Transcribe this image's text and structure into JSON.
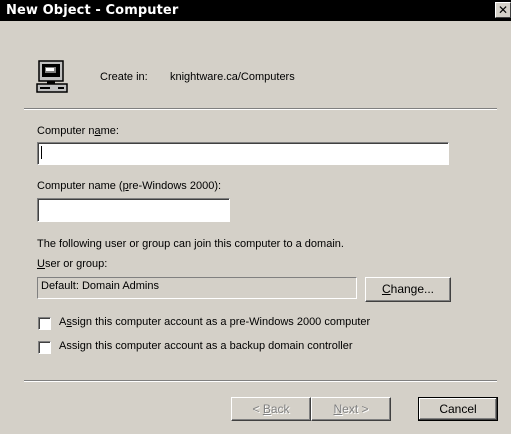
{
  "window": {
    "title": "New Object - Computer",
    "close_glyph": "✕"
  },
  "header": {
    "icon": "computer-icon",
    "create_in_label": "Create in:",
    "create_in_path": "knightware.ca/Computers"
  },
  "form": {
    "computer_name": {
      "label_pre": "Computer n",
      "label_mnemonic": "a",
      "label_post": "me:",
      "value": ""
    },
    "computer_name_pre2000": {
      "label_pre": "Computer name (",
      "label_mnemonic": "p",
      "label_post": "re-Windows 2000):",
      "value": ""
    },
    "join_domain_text": "The following user or group can join this computer to a domain.",
    "user_or_group": {
      "label_mnemonic": "U",
      "label_post": "ser or group:",
      "value": "Default: Domain Admins"
    },
    "change_button": {
      "mnemonic": "C",
      "rest": "hange..."
    },
    "checkbox_pre2000": {
      "checked": false,
      "label_pre": "A",
      "label_mnemonic": "s",
      "label_post": "sign this computer account as a pre-Windows 2000 computer"
    },
    "checkbox_bdc": {
      "checked": false,
      "label_pre": "Assi",
      "label_mnemonic": "g",
      "label_post": "n this computer account as a backup domain controller"
    }
  },
  "footer": {
    "back_button": {
      "pre": "< ",
      "mnemonic": "B",
      "rest": "ack",
      "enabled": false
    },
    "next_button": {
      "mnemonic": "N",
      "rest": "ext >",
      "enabled": false
    },
    "cancel_button": {
      "label": "Cancel",
      "enabled": true
    }
  },
  "colors": {
    "dialog_face": "#d4d0c8",
    "titlebar": "#000000",
    "disabled_text": "#808080"
  }
}
